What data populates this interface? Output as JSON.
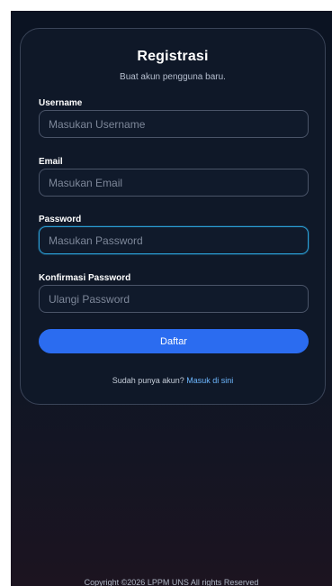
{
  "header": {
    "title": "Registrasi",
    "subtitle": "Buat akun pengguna baru."
  },
  "fields": {
    "username": {
      "label": "Username",
      "placeholder": "Masukan Username",
      "value": ""
    },
    "email": {
      "label": "Email",
      "placeholder": "Masukan Email",
      "value": ""
    },
    "password": {
      "label": "Password",
      "placeholder": "Masukan Password",
      "value": "",
      "focused": true
    },
    "confirm": {
      "label": "Konfirmasi Password",
      "placeholder": "Ulangi Password",
      "value": ""
    }
  },
  "submit_label": "Daftar",
  "login_prompt": {
    "text": "Sudah punya akun?",
    "link": "Masuk di sini"
  },
  "footer": "Copyright ©2026 LPPM UNS All rights Reserved",
  "colors": {
    "accent": "#2b6cf0",
    "focus_border": "#2a9fd6",
    "link": "#6db7ff",
    "background": "#0b1322"
  }
}
